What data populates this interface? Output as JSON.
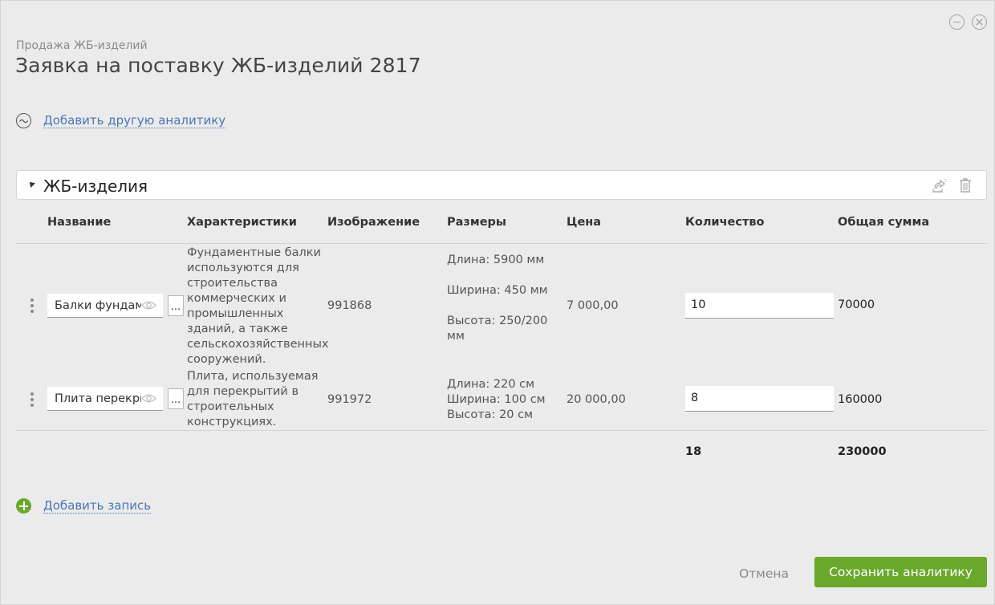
{
  "window": {
    "breadcrumb": "Продажа ЖБ-изделий",
    "title": "Заявка на поставку ЖБ-изделий 2817"
  },
  "analytics": {
    "add_label": "Добавить другую аналитику",
    "icon": "wave-icon"
  },
  "section": {
    "title": "ЖБ-изделия",
    "icons": [
      "export-icon",
      "trash-icon"
    ]
  },
  "table": {
    "columns": [
      "Название",
      "Характеристики",
      "Изображение",
      "Размеры",
      "Цена",
      "Количество",
      "Общая сумма"
    ],
    "rows": [
      {
        "name": "Балки фундаментные",
        "characteristics": "Фундаментные балки используются для строительства коммерческих и промышленных зданий, а также сельскохозяйственных сооружений.",
        "image": "991868",
        "sizes": [
          "Длина: 5900 мм",
          "Ширина: 450 мм",
          "Высота: 250/200 мм"
        ],
        "price": "7 000,00",
        "quantity": "10",
        "total": "70000"
      },
      {
        "name": "Плита перекрытия",
        "characteristics": "Плита, используемая для перекрытий в строительных конструкциях.",
        "image": "991972",
        "sizes": [
          "Длина: 220 см",
          "Ширина: 100 см",
          "Высота: 20 см"
        ],
        "price": "20 000,00",
        "quantity": "8",
        "total": "160000"
      }
    ],
    "lookup_label": "...",
    "sum_quantity": "18",
    "sum_total": "230000"
  },
  "add_record_label": "Добавить запись",
  "footer": {
    "cancel_label": "Отмена",
    "save_label": "Сохранить аналитику"
  },
  "colors": {
    "accent_green": "#6aa82c",
    "link_blue": "#4a77b5",
    "background": "#ebebeb"
  }
}
